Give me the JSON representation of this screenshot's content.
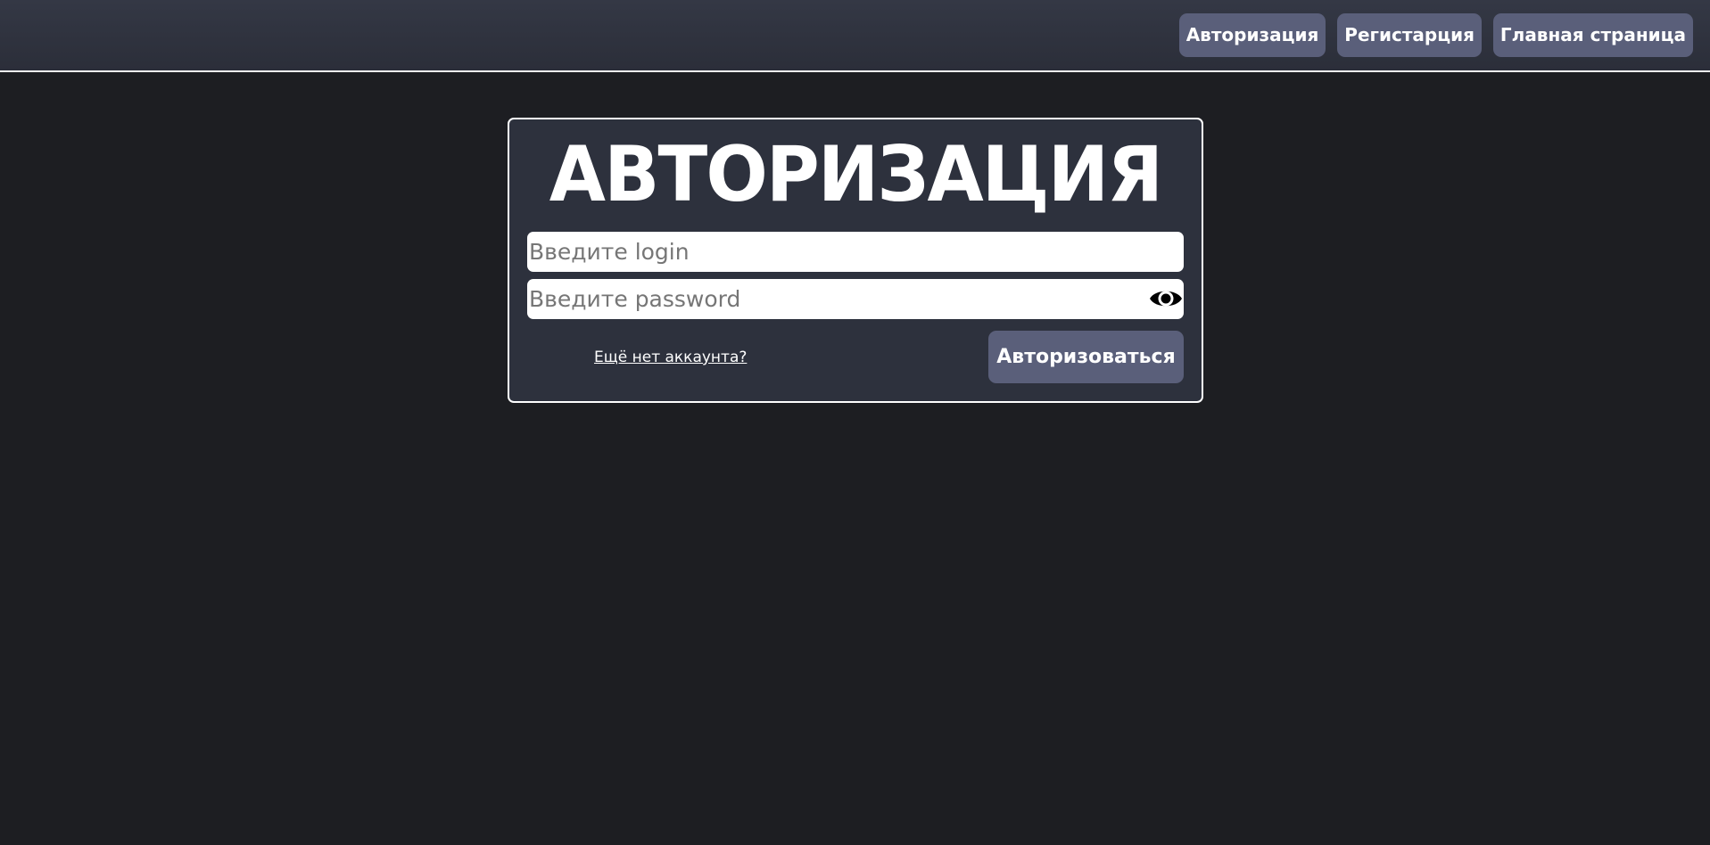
{
  "header": {
    "nav": [
      {
        "label": "Авторизация"
      },
      {
        "label": "Регистарция"
      },
      {
        "label": "Главная страница"
      }
    ]
  },
  "auth_form": {
    "title": "АВТОРИЗАЦИЯ",
    "login": {
      "placeholder": "Введите login",
      "value": ""
    },
    "password": {
      "placeholder": "Введите password",
      "value": "",
      "toggle_icon": "eye-icon"
    },
    "register_link": "Ещё нет аккаунта?",
    "submit_label": "Авторизоваться"
  },
  "colors": {
    "page_background": "#1d1e22",
    "header_background": "#2f323d",
    "card_background": "#2d313d",
    "button_background": "#5a5f7a",
    "text": "#ffffff"
  }
}
